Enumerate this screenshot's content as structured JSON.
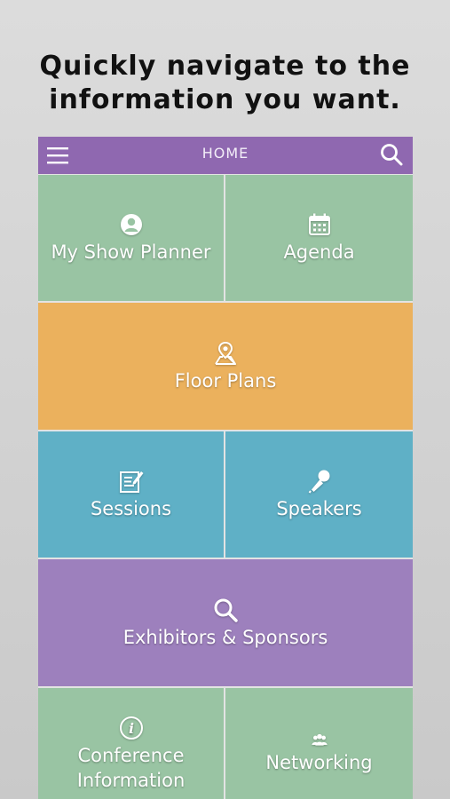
{
  "promo": {
    "line1": "Quickly navigate to the",
    "line2": "information you want."
  },
  "navbar": {
    "title": "HOME",
    "menu_icon": "hamburger-menu-icon",
    "search_icon": "search-icon"
  },
  "tiles": [
    {
      "label": "My Show Planner",
      "icon": "user-icon",
      "color": "#99c4a3"
    },
    {
      "label": "Agenda",
      "icon": "calendar-icon",
      "color": "#99c4a3"
    },
    {
      "label": "Floor Plans",
      "icon": "map-pin-icon",
      "color": "#ebb15d"
    },
    {
      "label": "Sessions",
      "icon": "edit-note-icon",
      "color": "#5fb0c6"
    },
    {
      "label": "Speakers",
      "icon": "microphone-icon",
      "color": "#5fb0c6"
    },
    {
      "label": "Exhibitors & Sponsors",
      "icon": "search-icon",
      "color": "#9d80bd"
    },
    {
      "label_line1": "Conference",
      "label_line2": "Information",
      "icon": "info-icon",
      "color": "#99c4a3"
    },
    {
      "label": "Networking",
      "icon": "people-group-icon",
      "color": "#99c4a3"
    }
  ]
}
